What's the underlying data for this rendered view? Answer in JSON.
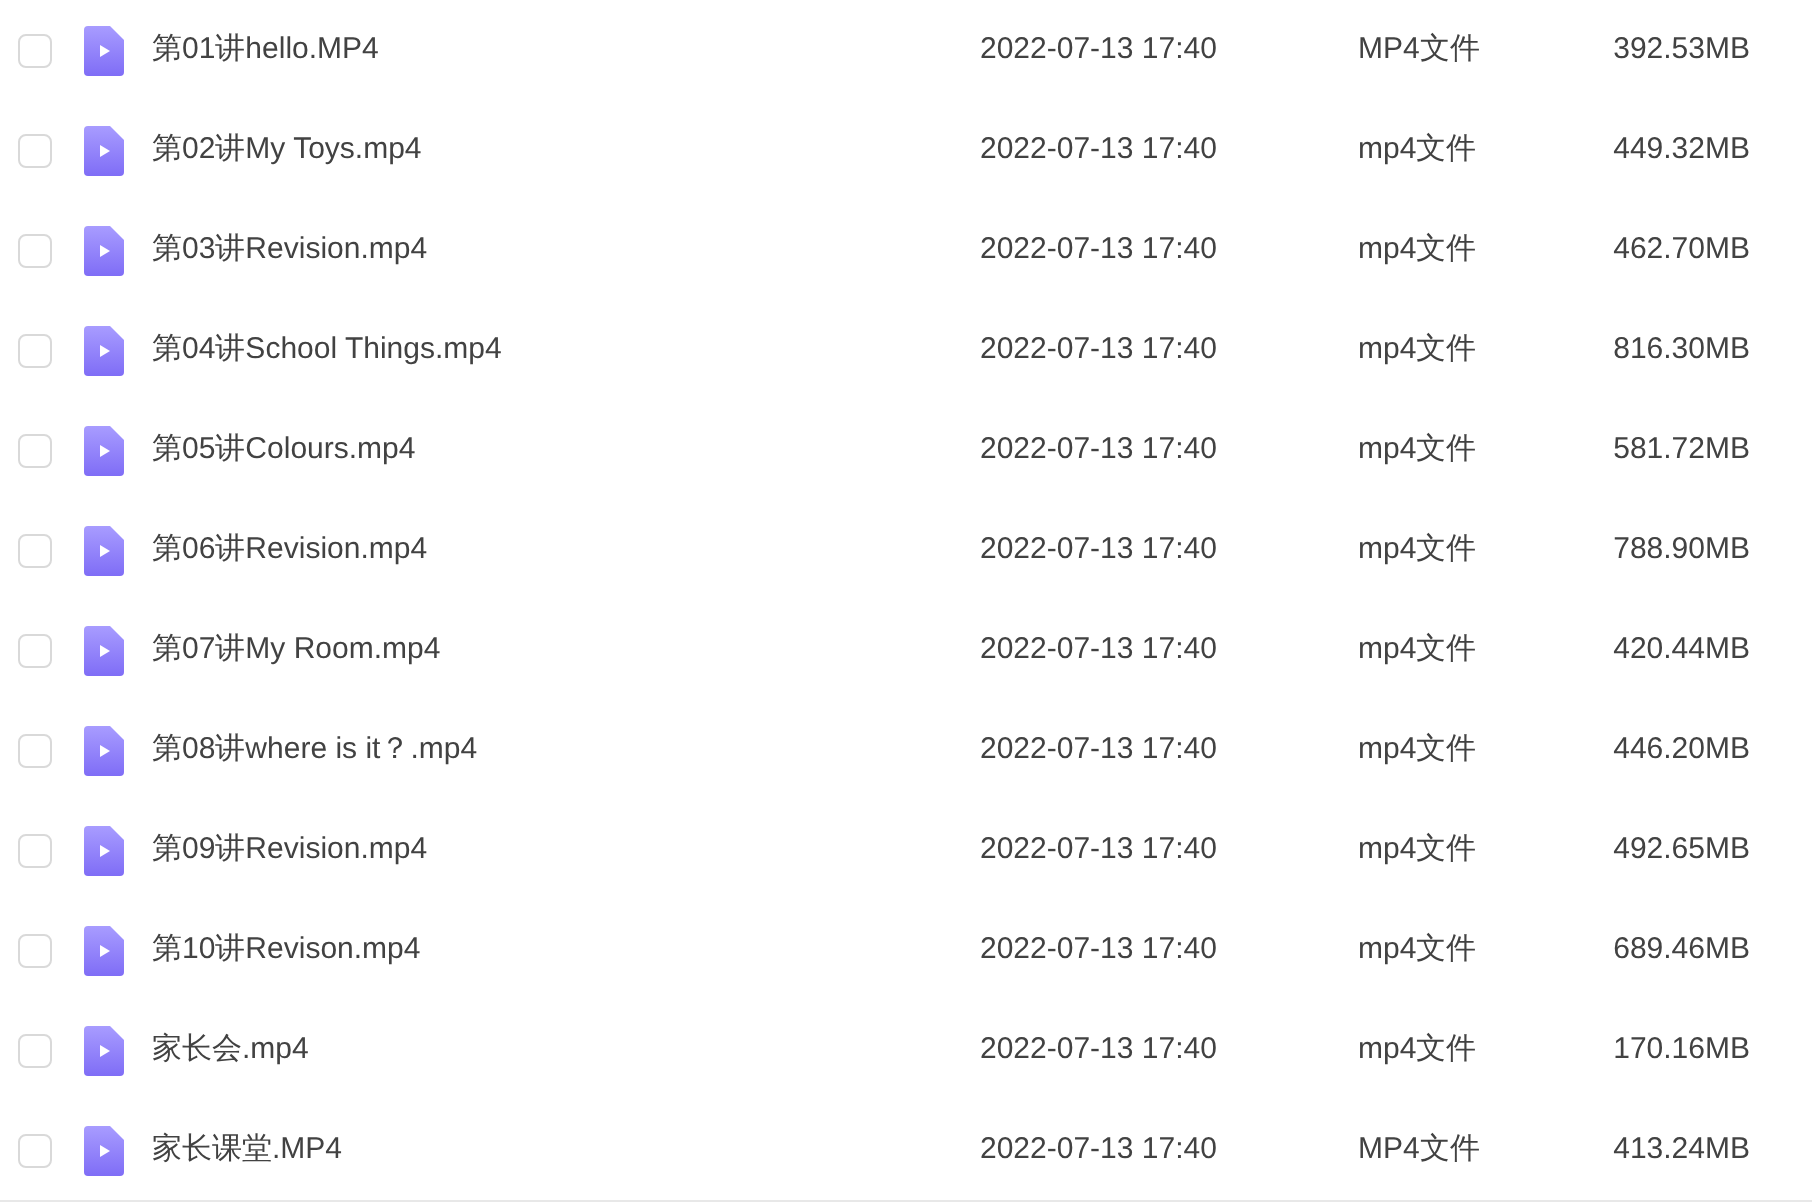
{
  "files": [
    {
      "name": "第01讲hello.MP4",
      "modified": "2022-07-13 17:40",
      "type": "MP4文件",
      "size": "392.53MB",
      "checked": false
    },
    {
      "name": "第02讲My Toys.mp4",
      "modified": "2022-07-13 17:40",
      "type": "mp4文件",
      "size": "449.32MB",
      "checked": false
    },
    {
      "name": "第03讲Revision.mp4",
      "modified": "2022-07-13 17:40",
      "type": "mp4文件",
      "size": "462.70MB",
      "checked": false
    },
    {
      "name": "第04讲School Things.mp4",
      "modified": "2022-07-13 17:40",
      "type": "mp4文件",
      "size": "816.30MB",
      "checked": false
    },
    {
      "name": "第05讲Colours.mp4",
      "modified": "2022-07-13 17:40",
      "type": "mp4文件",
      "size": "581.72MB",
      "checked": false
    },
    {
      "name": "第06讲Revision.mp4",
      "modified": "2022-07-13 17:40",
      "type": "mp4文件",
      "size": "788.90MB",
      "checked": false
    },
    {
      "name": "第07讲My Room.mp4",
      "modified": "2022-07-13 17:40",
      "type": "mp4文件",
      "size": "420.44MB",
      "checked": false
    },
    {
      "name": "第08讲where is it？.mp4",
      "modified": "2022-07-13 17:40",
      "type": "mp4文件",
      "size": "446.20MB",
      "checked": false
    },
    {
      "name": "第09讲Revision.mp4",
      "modified": "2022-07-13 17:40",
      "type": "mp4文件",
      "size": "492.65MB",
      "checked": false
    },
    {
      "name": "第10讲Revison.mp4",
      "modified": "2022-07-13 17:40",
      "type": "mp4文件",
      "size": "689.46MB",
      "checked": false
    },
    {
      "name": "家长会.mp4",
      "modified": "2022-07-13 17:40",
      "type": "mp4文件",
      "size": "170.16MB",
      "checked": false
    },
    {
      "name": "家长课堂.MP4",
      "modified": "2022-07-13 17:40",
      "type": "MP4文件",
      "size": "413.24MB",
      "checked": false
    }
  ]
}
